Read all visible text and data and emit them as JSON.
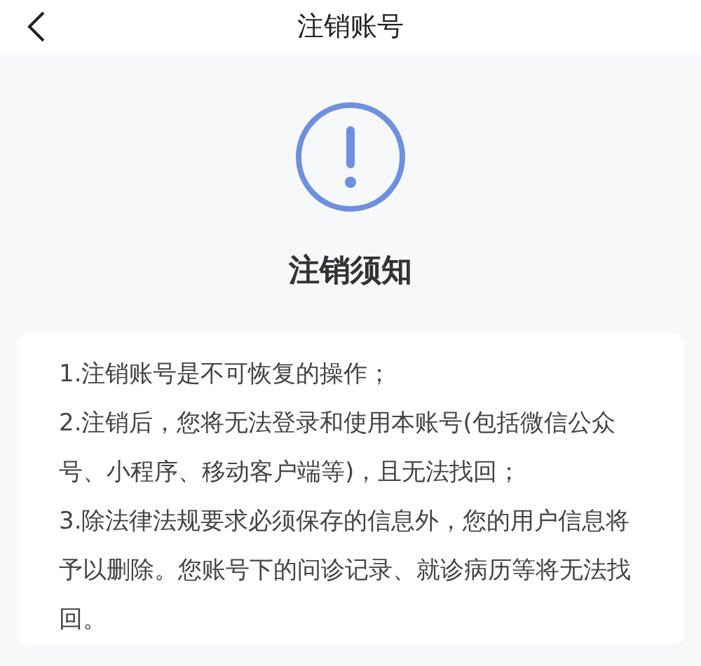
{
  "header": {
    "title": "注销账号"
  },
  "notice": {
    "title": "注销须知",
    "items": [
      "1.注销账号是不可恢复的操作；",
      "2.注销后，您将无法登录和使用本账号(包括微信公众号、小程序、移动客户端等)，且无法找回；",
      "3.除法律法规要求必须保存的信息外，您的用户信息将予以删除。您账号下的问诊记录、就诊病历等将无法找回。"
    ]
  }
}
